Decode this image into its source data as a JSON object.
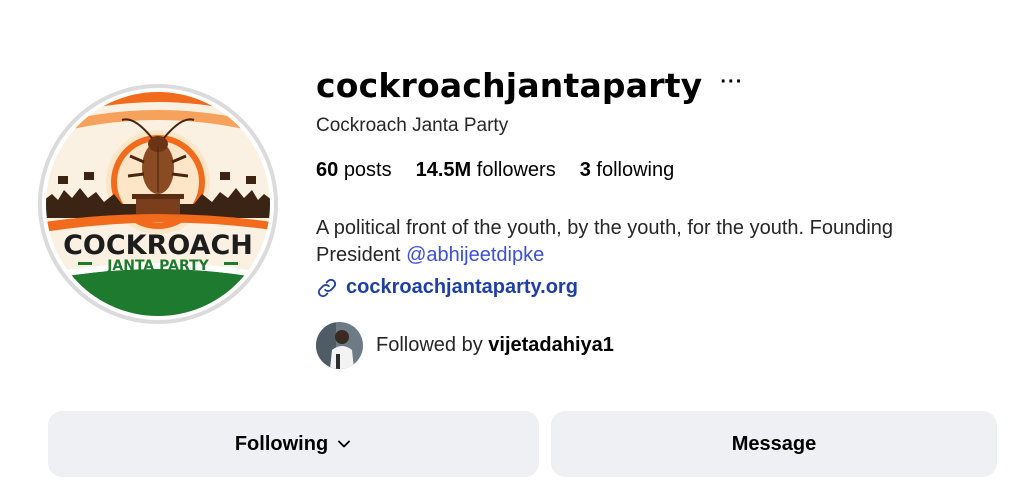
{
  "profile": {
    "username": "cockroachjantaparty",
    "more_glyph": "···",
    "full_name": "Cockroach Janta Party",
    "avatar_icon": "party-logo-icon",
    "logo_text_line1": "COCKROACH",
    "logo_text_line2": "JANTA PARTY"
  },
  "stats": {
    "posts_count": "60",
    "posts_label": "posts",
    "followers_count": "14.5M",
    "followers_label": "followers",
    "following_count": "3",
    "following_label": "following"
  },
  "bio": {
    "text": "A political front of the youth, by the youth, for the youth. Founding President ",
    "mention": "@abhijeetdipke"
  },
  "link": {
    "icon": "link-icon",
    "text": "cockroachjantaparty.org"
  },
  "followed_by": {
    "prefix": "Followed by ",
    "username": "vijetadahiya1"
  },
  "buttons": {
    "following_label": "Following",
    "message_label": "Message"
  },
  "colors": {
    "mention": "#3c4fd9",
    "link": "#1f3fa8",
    "button_bg": "#eef0f4",
    "saffron": "#f26a1b",
    "green": "#1e7a2e"
  }
}
